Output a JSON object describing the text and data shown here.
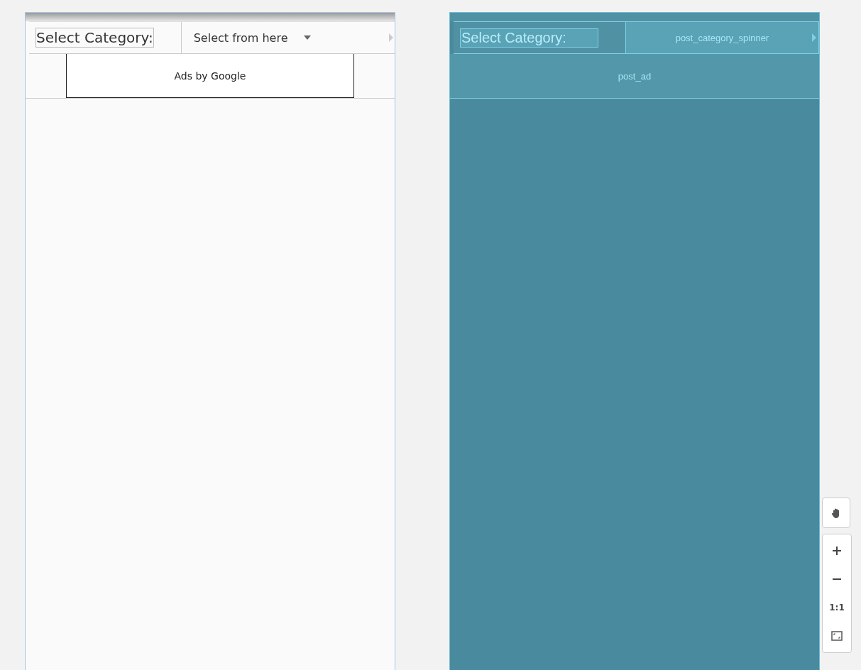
{
  "design": {
    "label": "Select Category:",
    "spinner": "Select from here",
    "ad": "Ads by Google"
  },
  "blueprint": {
    "label": "Select Category:",
    "spinner": "post_category_spinner",
    "ad": "post_ad"
  },
  "zoom_controls": {
    "actual_size": "1:1"
  }
}
